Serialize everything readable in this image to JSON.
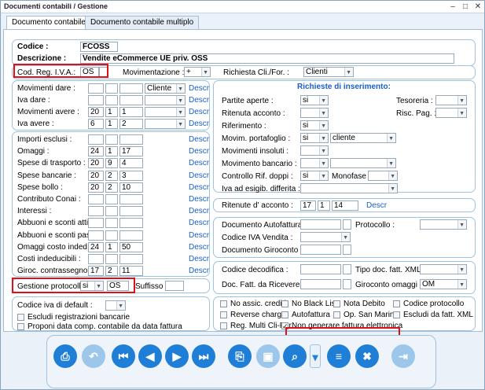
{
  "window": {
    "title": "Documenti contabili / Gestione"
  },
  "tabs": [
    "Documento contabile",
    "Documento contabile multiplo"
  ],
  "header": {
    "codice_label": "Codice :",
    "codice": "FCOSS",
    "descrizione_label": "Descrizione :",
    "descrizione": "Vendite eCommerce UE priv. OSS"
  },
  "reg": {
    "cod_reg_label": "Cod. Reg. I.V.A.:",
    "cod_reg": "OS",
    "movimentazione_label": "Movimentazione :",
    "movimentazione": "+",
    "richiesta_label": "Richiesta Cli./For. :",
    "richiesta": "Clienti"
  },
  "movimenti": {
    "rows": [
      {
        "label": "Movimenti dare :",
        "a": "",
        "b": "",
        "c": "",
        "sel": "Cliente",
        "descr": "Descr"
      },
      {
        "label": "Iva dare :",
        "a": "",
        "b": "",
        "c": "",
        "sel": "",
        "descr": "Descr"
      },
      {
        "label": "Movimenti avere :",
        "a": "20",
        "b": "1",
        "c": "1",
        "sel": "",
        "descr": "Descr"
      },
      {
        "label": "Iva avere :",
        "a": "6",
        "b": "1",
        "c": "2",
        "sel": "",
        "descr": "Descr"
      }
    ]
  },
  "importi": {
    "rows": [
      {
        "label": "Importi esclusi :",
        "a": "",
        "b": "",
        "c": "",
        "descr": "Descr"
      },
      {
        "label": "Omaggi :",
        "a": "24",
        "b": "1",
        "c": "17",
        "descr": "Descr"
      },
      {
        "label": "Spese di trasporto :",
        "a": "20",
        "b": "9",
        "c": "4",
        "descr": "Descr"
      },
      {
        "label": "Spese bancarie :",
        "a": "20",
        "b": "2",
        "c": "3",
        "descr": "Descr"
      },
      {
        "label": "Spese bollo :",
        "a": "20",
        "b": "2",
        "c": "10",
        "descr": "Descr"
      },
      {
        "label": "Contributo Conai :",
        "a": "",
        "b": "",
        "c": "",
        "descr": "Descr"
      },
      {
        "label": "Interessi :",
        "a": "",
        "b": "",
        "c": "",
        "descr": "Descr"
      },
      {
        "label": "Abbuoni e sconti attivi :",
        "a": "",
        "b": "",
        "c": "",
        "descr": "Descr"
      },
      {
        "label": "Abbuoni e sconti pass. :",
        "a": "",
        "b": "",
        "c": "",
        "descr": "Descr"
      },
      {
        "label": "Omaggi costo inded. :",
        "a": "24",
        "b": "1",
        "c": "50",
        "descr": "Descr"
      },
      {
        "label": "Costi indeducibili :",
        "a": "",
        "b": "",
        "c": "",
        "descr": "Descr"
      },
      {
        "label": "Giroc. contrassegno :",
        "a": "17",
        "b": "2",
        "c": "11",
        "descr": "Descr"
      }
    ]
  },
  "protocolli": {
    "label": "Gestione protocolli :",
    "value": "si",
    "code": "OS",
    "suffisso_label": "Suffisso :",
    "suffisso": ""
  },
  "iva_default": {
    "label": "Codice iva di default :",
    "value": ""
  },
  "left_checks": [
    "Escludi registrazioni bancarie",
    "Proponi data comp. contabile da data fattura"
  ],
  "richieste": {
    "title": "Richieste di inserimento:",
    "partite_aperte_label": "Partite aperte :",
    "partite_aperte": "si",
    "tesoreria_label": "Tesoreria :",
    "tesoreria": "",
    "ritenuta_acconto_label": "Ritenuta acconto :",
    "ritenuta_acconto": "",
    "risc_pag_label": "Risc. Pag. :",
    "risc_pag": "",
    "riferimento_label": "Riferimento :",
    "riferimento": "si",
    "movim_portafoglio_label": "Movim. portafoglio :",
    "movim_portafoglio": "si",
    "movim_portafoglio_sel": "cliente",
    "movimenti_insoluti_label": "Movimenti insoluti :",
    "movimenti_insoluti": "",
    "movimento_bancario_label": "Movimento bancario :",
    "movimento_bancario": "",
    "controllo_label": "Controllo Rif. doppi :",
    "controllo": "si",
    "monofase_label": "Monofase :",
    "monofase": "",
    "iva_esigib_label": "Iva ad esigib. differita :",
    "iva_esigib": ""
  },
  "ritenute": {
    "label": "Ritenute d' acconto :",
    "a": "17",
    "b": "1",
    "c": "14",
    "descr": "Descr"
  },
  "autofattura": {
    "doc_auto_label": "Documento Autofattura :",
    "doc_auto": "",
    "protocollo_label": "Protocollo :",
    "protocollo": "",
    "codice_iva_label": "Codice IVA Vendita :",
    "codice_iva": "",
    "giroconto_label": "Documento Giroconto :",
    "giroconto": ""
  },
  "decodifica": {
    "codice_label": "Codice decodifica :",
    "codice": "",
    "tipo_doc_label": "Tipo doc. fatt. XML :",
    "tipo_doc": "",
    "doc_fatt_label": "Doc. Fatt. da Ricevere :",
    "doc_fatt": "",
    "giroconto_omaggi_label": "Giroconto omaggi :",
    "giroconto_omaggi": "OM"
  },
  "checks": [
    {
      "label": "No assic. crediti",
      "checked": false
    },
    {
      "label": "No Black List",
      "checked": false
    },
    {
      "label": "Nota Debito",
      "checked": false
    },
    {
      "label": "Codice protocollo",
      "checked": false
    },
    {
      "label": "Reverse charge",
      "checked": false
    },
    {
      "label": "Autofattura",
      "checked": false
    },
    {
      "label": "Op. San Marino",
      "checked": false
    },
    {
      "label": "Escludi da fatt. XML",
      "checked": false
    },
    {
      "label": "Reg. Multi Cli-For",
      "checked": false
    },
    {
      "label": "Non generare fattura elettronica",
      "checked": true
    }
  ],
  "toolbar": [
    "print-icon",
    "undo-icon",
    "first-icon",
    "prev-icon",
    "next-icon",
    "last-icon",
    "save-icon",
    "disk-icon",
    "search-icon",
    "dropdown-icon",
    "list-icon",
    "delete-icon",
    "export-icon",
    "exit-icon",
    "copy-icon"
  ]
}
